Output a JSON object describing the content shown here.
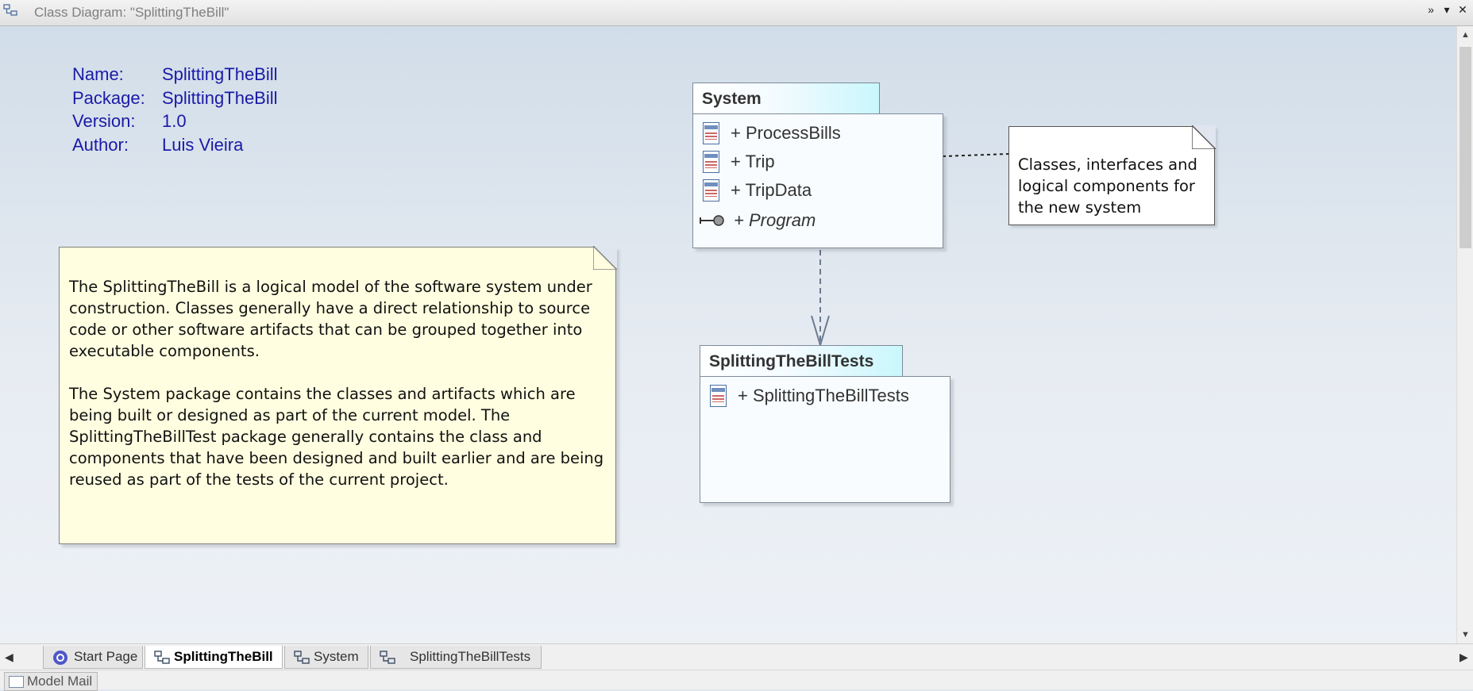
{
  "window": {
    "title": "Class Diagram: \"SplittingTheBill\"",
    "buttons": [
      "menu",
      "dropdown",
      "close"
    ]
  },
  "diagram_info": {
    "name_label": "Name:",
    "name_value": "SplittingTheBill",
    "package_label": "Package:",
    "package_value": "SplittingTheBill",
    "version_label": "Version:",
    "version_value": "1.0",
    "author_label": "Author:",
    "author_value": "Luis Vieira"
  },
  "main_note": {
    "paragraph1": "The SplittingTheBill is a logical model of the software system under construction. Classes generally have a direct relationship to source code or other software artifacts that can be grouped together into executable components.",
    "paragraph2": "The System package contains the classes and artifacts which are being built or designed as part of the current model. The SplittingTheBillTest package generally contains the class and components that have been designed and built earlier and are being reused as part of the tests of the current project."
  },
  "side_note": {
    "text": "Classes, interfaces and logical components for the new system"
  },
  "system_package": {
    "name": "System",
    "items": [
      {
        "label": "+ ProcessBills",
        "icon": "class-icon"
      },
      {
        "label": "+ Trip",
        "icon": "class-icon"
      },
      {
        "label": "+ TripData",
        "icon": "class-icon"
      },
      {
        "label": "+ Program",
        "icon": "interface-icon",
        "italic": true
      }
    ]
  },
  "tests_package": {
    "name": "SplittingTheBillTests",
    "items": [
      {
        "label": "+ SplittingTheBillTests",
        "icon": "class-icon"
      }
    ]
  },
  "tabs": [
    {
      "label": "Start Page",
      "icon": "start-page-icon",
      "active": false
    },
    {
      "label": "SplittingTheBill",
      "icon": "diagram-icon",
      "active": true
    },
    {
      "label": "System",
      "icon": "diagram-icon",
      "active": false
    },
    {
      "label": "SplittingTheBillTests",
      "icon": "diagram-icon",
      "active": false
    }
  ],
  "status": {
    "model_mail": "Model Mail"
  },
  "colors": {
    "info_text": "#1a1aa6",
    "note_bg": "#fffee0",
    "package_tab_accent": "#c9f7fc",
    "canvas_top": "#d1dde9"
  }
}
